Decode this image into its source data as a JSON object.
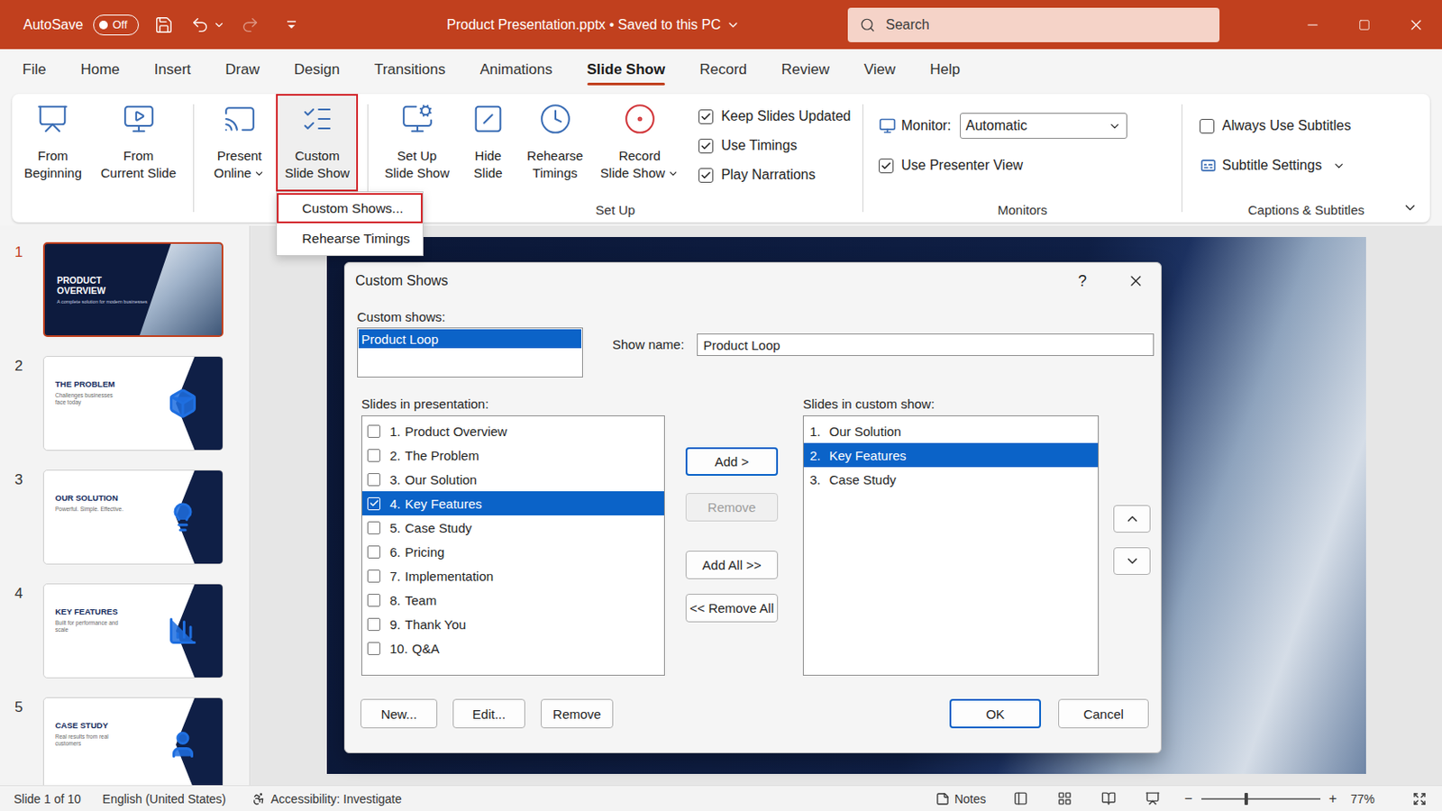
{
  "window": {
    "title": "Product Presentation.pptx • Saved to this PC",
    "autosave": {
      "label": "AutoSave",
      "state": "Off",
      "on": false
    },
    "redo_disabled": true
  },
  "search": {
    "placeholder": "Search"
  },
  "tabs": [
    {
      "label": "File",
      "selected": false
    },
    {
      "label": "Home",
      "selected": false
    },
    {
      "label": "Insert",
      "selected": false
    },
    {
      "label": "Draw",
      "selected": false
    },
    {
      "label": "Design",
      "selected": false
    },
    {
      "label": "Transitions",
      "selected": false
    },
    {
      "label": "Animations",
      "selected": false
    },
    {
      "label": "Slide Show",
      "selected": true
    },
    {
      "label": "Record",
      "selected": false
    },
    {
      "label": "Review",
      "selected": false
    },
    {
      "label": "View",
      "selected": false
    },
    {
      "label": "Help",
      "selected": false
    }
  ],
  "ribbon": {
    "groups": [
      {
        "items": [
          {
            "kind": "big",
            "lines": [
              "From",
              "Beginning"
            ],
            "dropdown": false,
            "highlighted": false
          },
          {
            "kind": "big",
            "lines": [
              "From",
              "Current Slide"
            ],
            "dropdown": false,
            "highlighted": false
          }
        ]
      },
      {
        "items": [
          {
            "kind": "big",
            "lines": [
              "Present",
              "Online"
            ],
            "dropdown": true,
            "highlighted": false
          },
          {
            "kind": "big",
            "lines": [
              "Custom",
              "Slide Show"
            ],
            "dropdown": false,
            "highlighted": true,
            "expanded": true,
            "menu": {
              "items": [
                {
                  "label": "Custom Shows...",
                  "highlighted": true
                },
                {
                  "label": "Rehearse Timings",
                  "highlighted": false
                }
              ]
            }
          }
        ]
      },
      {
        "label": "Set Up",
        "items": [
          {
            "kind": "big",
            "lines": [
              "Set Up",
              "Slide Show"
            ],
            "dropdown": false,
            "highlighted": false
          },
          {
            "kind": "big",
            "lines": [
              "Hide",
              "Slide"
            ],
            "dropdown": false,
            "highlighted": false
          },
          {
            "kind": "big",
            "lines": [
              "Rehearse",
              "Timings"
            ],
            "dropdown": false,
            "highlighted": false
          },
          {
            "kind": "big",
            "lines": [
              "Record",
              "Slide Show"
            ],
            "dropdown": true,
            "highlighted": false
          },
          {
            "kind": "checks",
            "checks": [
              {
                "label": "Keep Slides Updated",
                "checked": true
              },
              {
                "label": "Use Timings",
                "checked": true
              },
              {
                "label": "Play Narrations",
                "checked": true
              }
            ]
          }
        ]
      },
      {
        "label": "Monitors",
        "items": [
          {
            "kind": "monitor",
            "label": "Monitor:",
            "value": "Automatic",
            "checks": [
              {
                "label": "Use Presenter View",
                "checked": true
              }
            ]
          }
        ]
      },
      {
        "label": "Captions & Subtitles",
        "items": [
          {
            "kind": "captions",
            "checks": [
              {
                "label": "Always Use Subtitles",
                "checked": false
              }
            ],
            "settings": {
              "label": "Subtitle Settings",
              "dropdown": true
            }
          }
        ]
      }
    ]
  },
  "slides": [
    {
      "number": "1",
      "title": "PRODUCT OVERVIEW",
      "subtitle": "A complete solution for modern businesses",
      "kind": "cover",
      "selected": true
    },
    {
      "number": "2",
      "title": "THE PROBLEM",
      "subtitle": "Challenges businesses face today",
      "kind": "content",
      "selected": false
    },
    {
      "number": "3",
      "title": "OUR SOLUTION",
      "subtitle": "Powerful. Simple. Effective.",
      "kind": "content",
      "selected": false
    },
    {
      "number": "4",
      "title": "KEY FEATURES",
      "subtitle": "Built for performance and scale",
      "kind": "content",
      "selected": false
    },
    {
      "number": "5",
      "title": "CASE STUDY",
      "subtitle": "Real results from real customers",
      "kind": "content",
      "selected": false
    }
  ],
  "dialog": {
    "title": "Custom Shows",
    "help": "?",
    "custom_shows": {
      "label": "Custom shows:",
      "items": [
        {
          "label": "Product Loop",
          "selected": true
        }
      ]
    },
    "show_name": {
      "label": "Show name:",
      "value": "Product Loop"
    },
    "available": {
      "label": "Slides in presentation:",
      "items": [
        {
          "number": "1.",
          "label": "Product Overview",
          "checked": false,
          "selected": false
        },
        {
          "number": "2.",
          "label": "The Problem",
          "checked": false,
          "selected": false
        },
        {
          "number": "3.",
          "label": "Our Solution",
          "checked": false,
          "selected": false
        },
        {
          "number": "4.",
          "label": "Key Features",
          "checked": true,
          "selected": true
        },
        {
          "number": "5.",
          "label": "Case Study",
          "checked": false,
          "selected": false
        },
        {
          "number": "6.",
          "label": "Pricing",
          "checked": false,
          "selected": false
        },
        {
          "number": "7.",
          "label": "Implementation",
          "checked": false,
          "selected": false
        },
        {
          "number": "8.",
          "label": "Team",
          "checked": false,
          "selected": false
        },
        {
          "number": "9.",
          "label": "Thank You",
          "checked": false,
          "selected": false
        },
        {
          "number": "10.",
          "label": "Q&A",
          "checked": false,
          "selected": false
        }
      ]
    },
    "included": {
      "label": "Slides in custom show:",
      "items": [
        {
          "number": "1.",
          "label": "Our Solution",
          "selected": false
        },
        {
          "number": "2.",
          "label": "Key Features",
          "selected": true
        },
        {
          "number": "3.",
          "label": "Case Study",
          "selected": false
        }
      ]
    },
    "transfer_buttons": [
      {
        "label": "Add >",
        "default": true,
        "disabled": false
      },
      {
        "label": "Remove",
        "default": false,
        "disabled": true
      },
      {
        "label": "Add All >>",
        "default": false,
        "disabled": false
      },
      {
        "label": "<< Remove All",
        "default": false,
        "disabled": false
      }
    ],
    "left_buttons": [
      {
        "label": "New..."
      },
      {
        "label": "Edit..."
      },
      {
        "label": "Remove"
      }
    ],
    "right_buttons": [
      {
        "label": "OK",
        "default": true
      },
      {
        "label": "Cancel",
        "default": false
      }
    ]
  },
  "status_bar": {
    "slide": "Slide 1 of 10",
    "language": "English (United States)",
    "accessibility": "Accessibility: Investigate",
    "notes": "Notes",
    "zoom": {
      "minus": "−",
      "plus": "+",
      "level": 0.38,
      "reading": "77%"
    }
  }
}
